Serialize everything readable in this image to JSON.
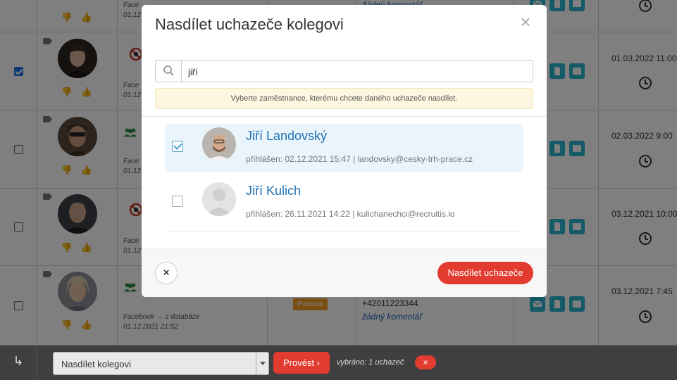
{
  "modal": {
    "title": "Nasdílet uchazeče kolegovi",
    "search_value": "jiří",
    "hint": "Vyberte zaměstnance, kterému chcete daného uchazeče nasdílet.",
    "employees": [
      {
        "name": "Jiří Landovský",
        "meta": "přihlášen: 02.12.2021 15:47 | landovsky@cesky-trh-prace.cz",
        "selected": true
      },
      {
        "name": "Jiří Kulich",
        "meta": "přihlášen: 26.11.2021 14:22 | kulichanechci@recruitis.io",
        "selected": false
      }
    ],
    "share_label": "Nasdílet uchazeče",
    "cancel_glyph": "×",
    "close_glyph": "×"
  },
  "table": {
    "rows": [
      {
        "source": "Face",
        "date2": "01.12",
        "comment": "žádný komentář",
        "date": ""
      },
      {
        "source": "Face",
        "date2": "01.12",
        "date": "01.03.2022 11:00"
      },
      {
        "source": "Face",
        "date2": "01.12",
        "date": "02.03.2022 9:00"
      },
      {
        "source": "Face",
        "date2": "01.12",
        "date": "03.12.2021 10:00"
      },
      {
        "source": "Facebook → z databáze",
        "date2": "01.12.2021 21:52",
        "status": "Pohovor",
        "phone": "+42011223344",
        "comment": "žádný komentář",
        "date": "03.12.2021 7:45"
      }
    ]
  },
  "bottom_bar": {
    "arrow_glyph": "↳",
    "action_select": "Nasdílet kolegovi",
    "run_label": "Provést ›",
    "selected_text": "vybráno: 1 uchazeč",
    "clear_glyph": "×"
  },
  "colors": {
    "accent_red": "#e23c31",
    "link_blue": "#2372b5",
    "action_teal": "#2bb4cf",
    "status_orange": "#f39c27"
  }
}
